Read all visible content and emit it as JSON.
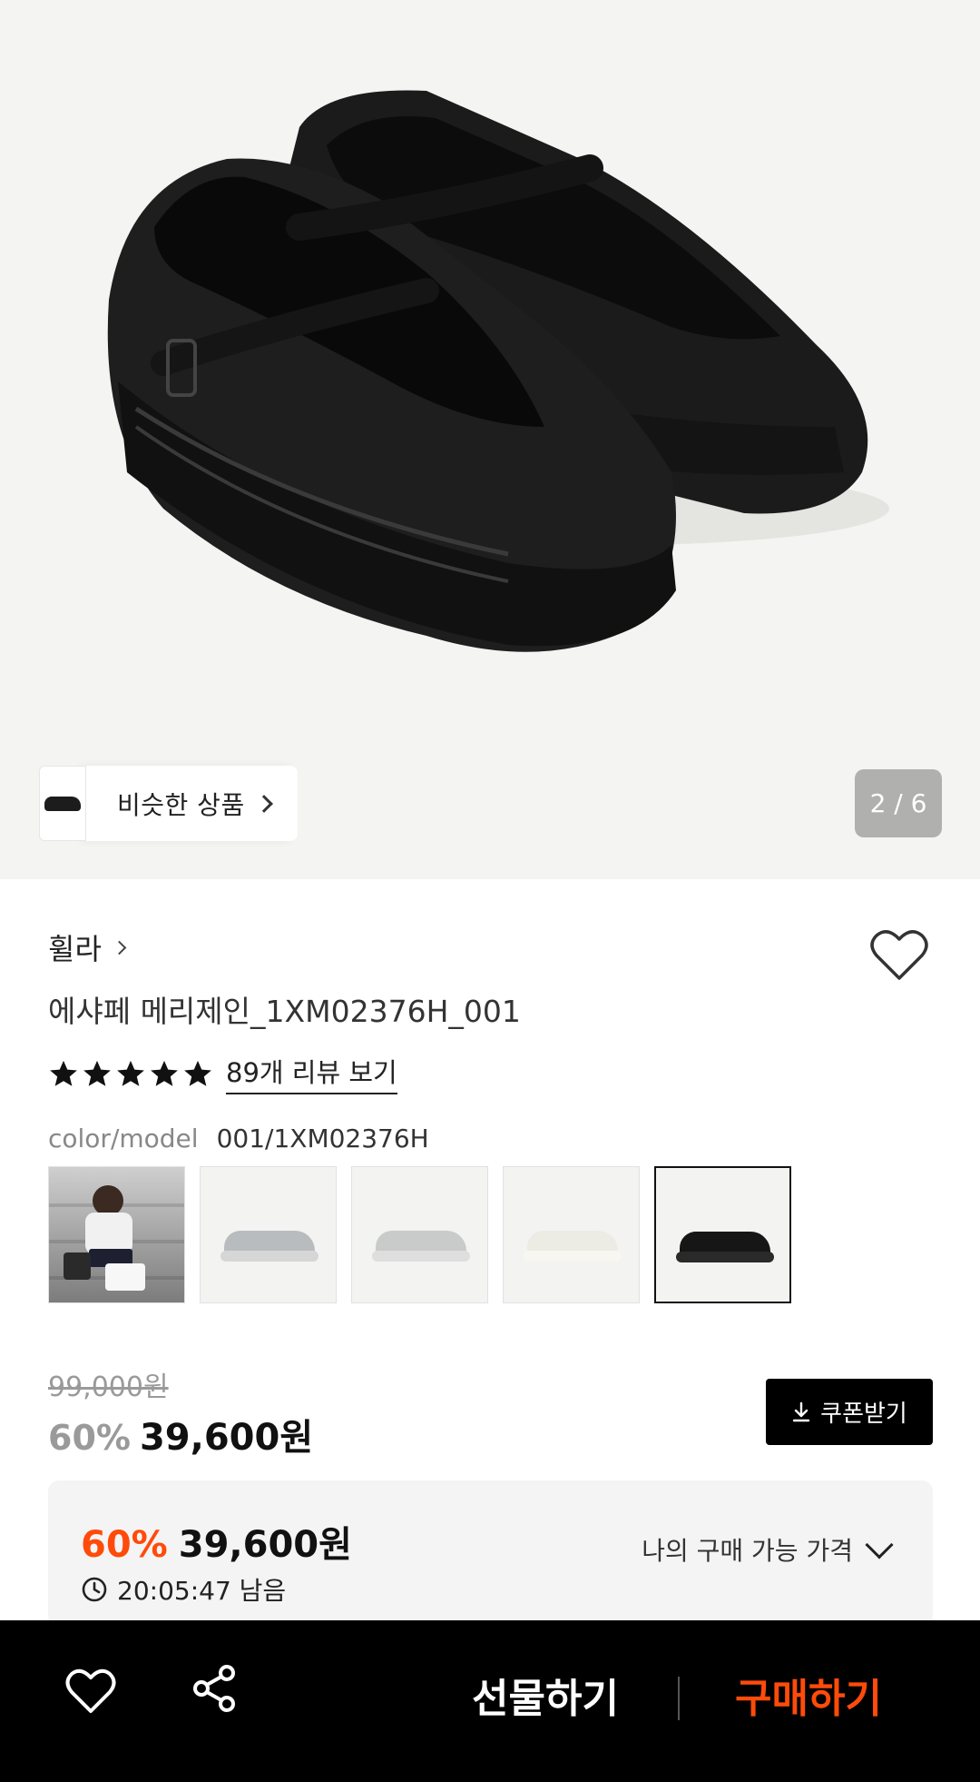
{
  "hero": {
    "similar_label": "비슷한 상품",
    "pager": "2 / 6"
  },
  "product": {
    "brand": "휠라",
    "title": "에샤페 메리제인_1XM02376H_001",
    "rating_stars": 5,
    "review_link": "89개 리뷰 보기",
    "color_label": "color/model",
    "color_value": "001/1XM02376H",
    "swatches": [
      {
        "name": "model-photo",
        "selected": false
      },
      {
        "name": "silver-gray",
        "color": "#b9bcbf",
        "selected": false
      },
      {
        "name": "light-gray",
        "color": "#c9cbcb",
        "selected": false
      },
      {
        "name": "ivory",
        "color": "#ecebe4",
        "selected": false
      },
      {
        "name": "black",
        "color": "#161616",
        "selected": true
      }
    ]
  },
  "pricing": {
    "original": "99,000원",
    "discount": "60%",
    "price": "39,600원",
    "coupon_label": "쿠폰받기"
  },
  "my_price": {
    "discount": "60%",
    "price": "39,600원",
    "timer": "20:05:47 남음",
    "label": "나의 구매 가능 가격"
  },
  "bottom_bar": {
    "gift_label": "선물하기",
    "buy_label": "구매하기"
  },
  "colors": {
    "accent": "#ff4b0a",
    "bar_bg": "#000000"
  }
}
